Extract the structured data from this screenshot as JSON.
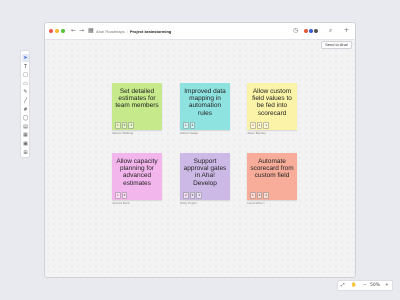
{
  "window": {
    "controls": {
      "close": "#ef5a52",
      "minimize": "#f5bd32",
      "maximize": "#57c13e"
    },
    "nav_icons": [
      "back-arrow-icon",
      "forward-arrow-icon",
      "board-icon"
    ],
    "breadcrumb": {
      "parent": "Aha! Roadmaps",
      "separator": "/",
      "current": "Project brainstorming"
    },
    "right_icons": [
      "history-icon",
      "search-icon",
      "add-icon"
    ],
    "avatar_colors": [
      "#e2563a",
      "#3b5ed6",
      "#555555"
    ]
  },
  "toolbar": {
    "send_label": "Send to Aha!",
    "tools": [
      {
        "name": "select-tool",
        "icon": "arrow-pointer-icon",
        "active": true
      },
      {
        "name": "text-tool",
        "icon": "text-icon",
        "active": false
      },
      {
        "name": "shape-tool",
        "icon": "square-icon",
        "active": false
      },
      {
        "name": "sticky-note-tool",
        "icon": "sticky-note-icon",
        "active": false
      },
      {
        "name": "pen-tool",
        "icon": "pen-icon",
        "active": false
      },
      {
        "name": "line-tool",
        "icon": "line-icon",
        "active": false
      },
      {
        "name": "frame-tool",
        "icon": "frame-icon",
        "active": false
      },
      {
        "name": "comment-tool",
        "icon": "comment-icon",
        "active": false
      },
      {
        "name": "table-tool",
        "icon": "table-icon",
        "active": false
      },
      {
        "name": "template-tool",
        "icon": "grid-icon",
        "active": false
      },
      {
        "name": "image-tool",
        "icon": "image-icon",
        "active": false
      },
      {
        "name": "embed-tool",
        "icon": "embed-icon",
        "active": false
      }
    ]
  },
  "notes": [
    {
      "text": "Set detailed estimates for team members",
      "color": "#c6ea8b",
      "badges": [
        "1",
        "3",
        "1"
      ],
      "author": "Alberto Whitting"
    },
    {
      "text": "Improved data mapping in automation rules",
      "color": "#8ee3e0",
      "badges": [
        "1",
        "4"
      ],
      "author": "Gilbert Nwaje"
    },
    {
      "text": "Allow custom field values to be fed into scorecard",
      "color": "#fbf3a8",
      "badges": [
        "2",
        "1",
        "1"
      ],
      "author": "Jason Bentley"
    },
    {
      "text": "Allow capacity planning for advanced estimates",
      "color": "#f3b6ec",
      "badges": [
        "1",
        "3"
      ],
      "author": "Jessica Beck"
    },
    {
      "text": "Support approval gates in Aha! Develop",
      "color": "#cdb9e6",
      "badges": [
        "2",
        "3",
        "1"
      ],
      "author": "Nicky Knight"
    },
    {
      "text": "Automate scorecard from custom field",
      "color": "#f7ad9a",
      "badges": [
        "1",
        "3",
        "1"
      ],
      "author": "Laura Wilson"
    }
  ],
  "zoom": {
    "fit_icon": "expand-icon",
    "pan_icon": "hand-icon",
    "minus": "−",
    "level": "50%",
    "plus": "+"
  }
}
